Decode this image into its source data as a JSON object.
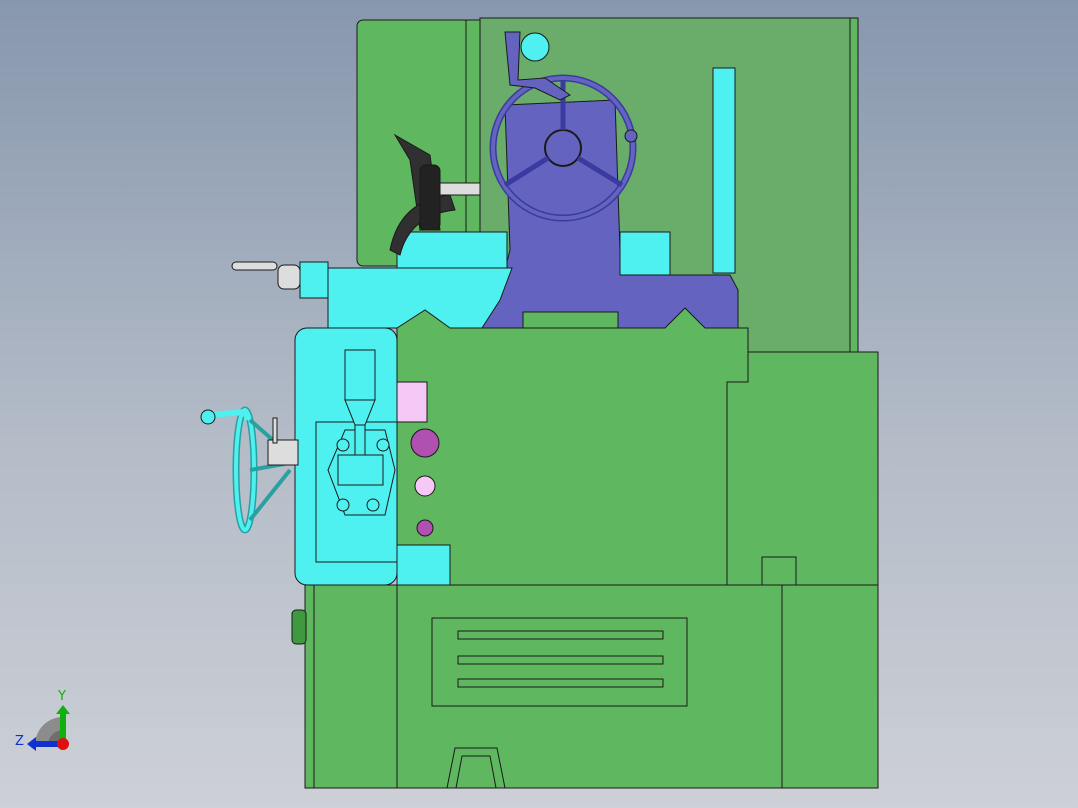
{
  "viewport": {
    "view": "cad-model-side-view"
  },
  "colors": {
    "body_green": "#5fb75f",
    "panel_green": "#6aac6a",
    "cyan": "#4ff0f0",
    "column_blue": "#6464c0",
    "pink": "#b050b0",
    "light_pink": "#f5c8f5",
    "outline": "#1a1a1a"
  },
  "triad": {
    "y_label": "Y",
    "z_label": "Z",
    "x_color": "#e01010",
    "y_color": "#10b010",
    "z_color": "#1030d0"
  }
}
